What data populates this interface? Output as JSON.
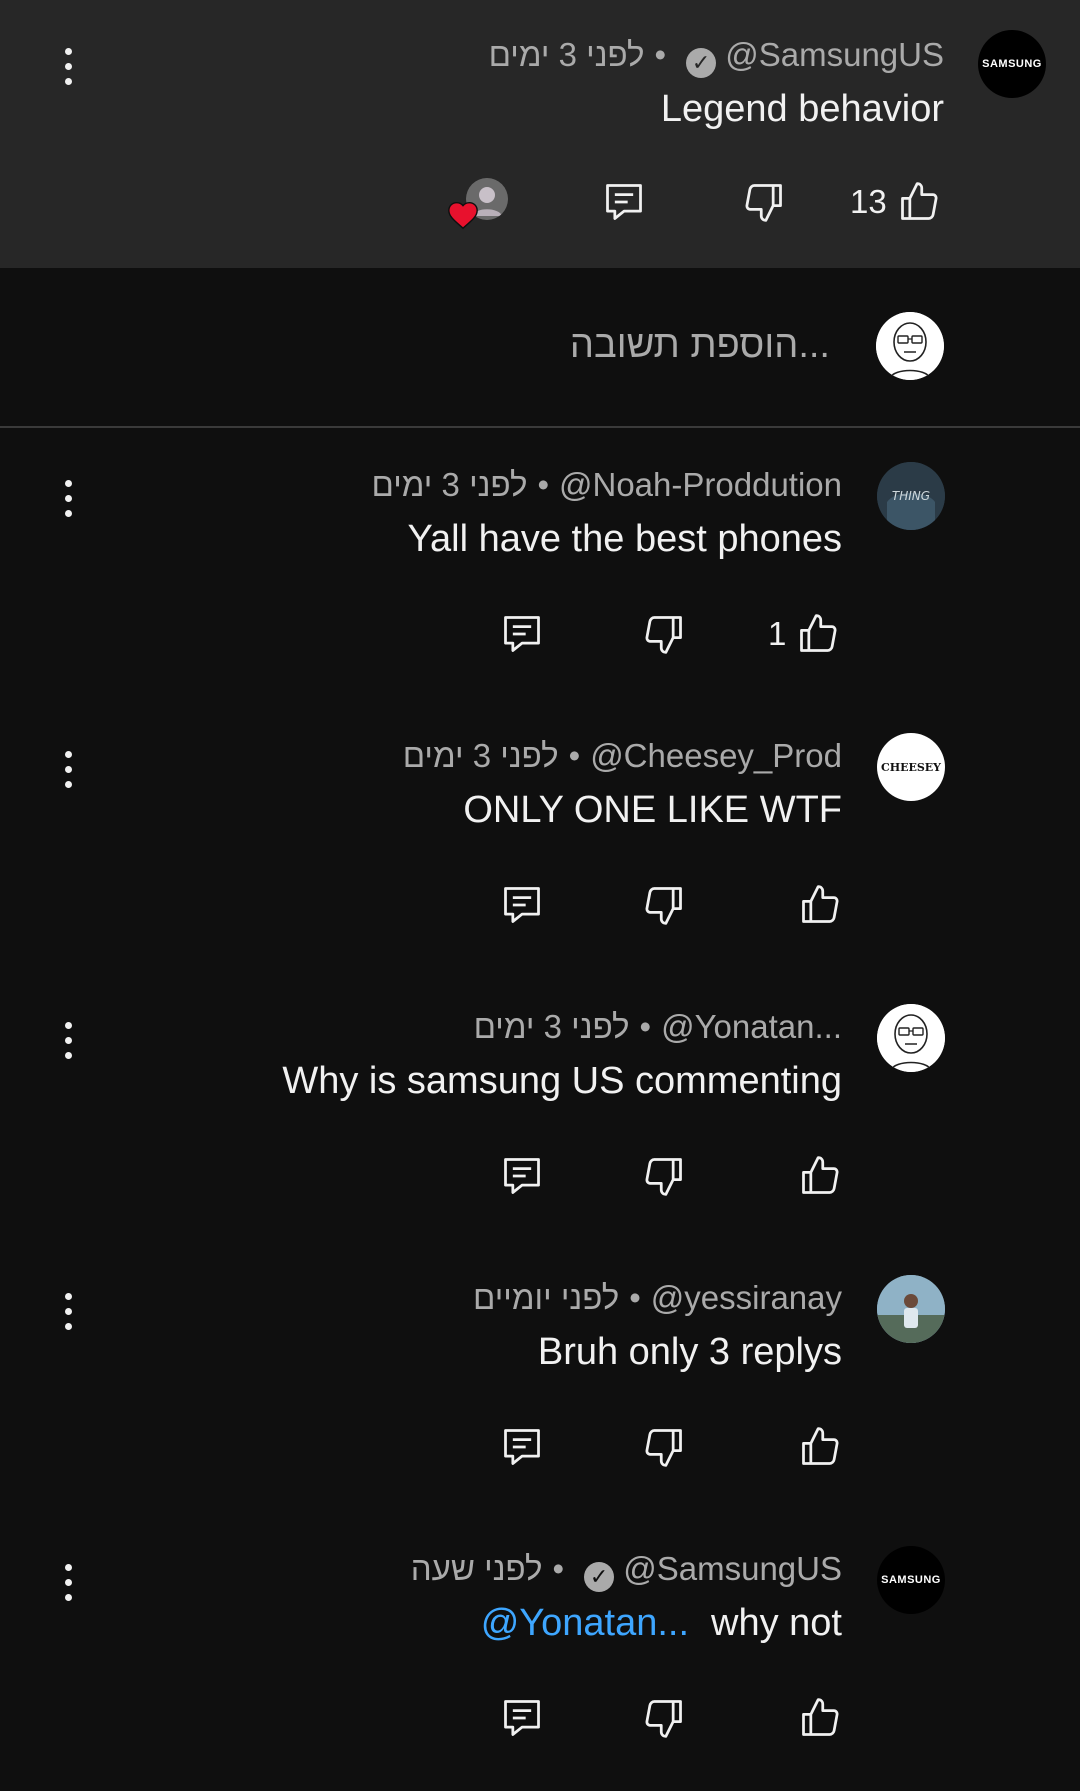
{
  "top_comment": {
    "handle": "@SamsungUS",
    "time": "לפני 3 ימים",
    "text": "Legend behavior",
    "likes": "13",
    "avatar_text": "SAMSUNG"
  },
  "reply_input": {
    "placeholder": "הוספת תשובה..."
  },
  "replies": [
    {
      "handle": "@Noah-Proddution",
      "time": "לפני 3 ימים",
      "text": "Yall have the best phones",
      "likes": "1",
      "verified": false,
      "mention": ""
    },
    {
      "handle": "@Cheesey_Prod",
      "time": "לפני 3 ימים",
      "text": "ONLY ONE LIKE WTF",
      "likes": "",
      "verified": false,
      "mention": "",
      "avatar_text": "CHEESEY"
    },
    {
      "handle": "@Yonatan...",
      "time": "לפני 3 ימים",
      "text": "Why is samsung US commenting",
      "likes": "",
      "verified": false,
      "mention": ""
    },
    {
      "handle": "@yessiranay",
      "time": "לפני יומיים",
      "text": "Bruh only 3 replys",
      "likes": "",
      "verified": false,
      "mention": ""
    },
    {
      "handle": "@SamsungUS",
      "time": "לפני שעה",
      "text": "why not",
      "likes": "",
      "verified": true,
      "mention": "@Yonatan...",
      "avatar_text": "SAMSUNG"
    }
  ],
  "separator": "•",
  "colors": {
    "background": "#0f0f0f",
    "highlight_background": "#272727",
    "text": "#f1f1f1",
    "secondary_text": "#aaaaaa",
    "mention": "#3ea6ff",
    "heart": "#e8112d"
  }
}
